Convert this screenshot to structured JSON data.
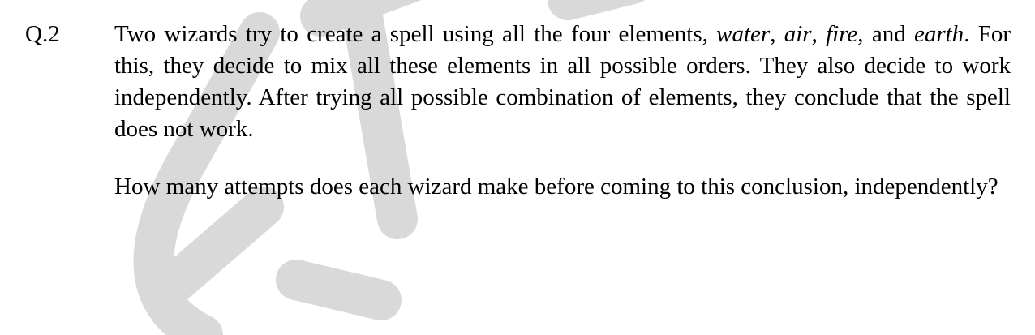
{
  "question": {
    "number": "Q.2",
    "paragraph1": {
      "t1": "Two wizards try to create a spell using all the four elements, ",
      "e1": "water",
      "t2": ", ",
      "e2": "air",
      "t3": ", ",
      "e3": "fire",
      "t4": ", and ",
      "e4": "earth",
      "t5": ". For this, they decide to mix all these elements in all possible orders. They also decide to work independently. After trying all possible combination of elements, they conclude that the spell does not work."
    },
    "paragraph2": "How many attempts does each wizard make before coming to this conclusion, independently?"
  },
  "colors": {
    "watermark": "#d9d9d9",
    "text": "#000000"
  }
}
